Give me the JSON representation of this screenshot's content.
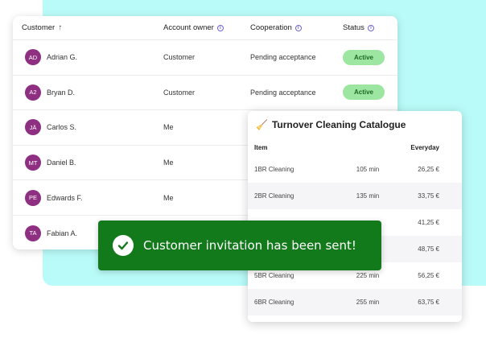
{
  "colors": {
    "background_panel": "#b9fbf8",
    "avatar": "#8e2f82",
    "badge_bg": "#9ce6a2",
    "badge_text": "#1d6a24",
    "toast_bg": "#137a1c",
    "info_icon": "#6d65d8"
  },
  "customers_table": {
    "headers": {
      "customer": "Customer",
      "account_owner": "Account owner",
      "cooperation": "Cooperation",
      "status": "Status"
    },
    "rows": [
      {
        "initials": "AD",
        "name": "Adrian G.",
        "owner": "Customer",
        "cooperation": "Pending acceptance",
        "status": "Active"
      },
      {
        "initials": "A2",
        "name": "Bryan D.",
        "owner": "Customer",
        "cooperation": "Pending acceptance",
        "status": "Active"
      },
      {
        "initials": "JÄ",
        "name": "Carlos S.",
        "owner": "Me",
        "cooperation": "",
        "status": ""
      },
      {
        "initials": "MT",
        "name": "Daniel B.",
        "owner": "Me",
        "cooperation": "",
        "status": ""
      },
      {
        "initials": "PE",
        "name": "Edwards F.",
        "owner": "Me",
        "cooperation": "",
        "status": ""
      },
      {
        "initials": "TA",
        "name": "Fabian A.",
        "owner": "",
        "cooperation": "",
        "status": ""
      }
    ]
  },
  "catalogue": {
    "icon": "broom-icon",
    "title": "Turnover Cleaning Catalogue",
    "headers": {
      "item": "Item",
      "price": "Everyday"
    },
    "rows": [
      {
        "item": "1BR Cleaning",
        "duration": "105 min",
        "price": "26,25 €"
      },
      {
        "item": "2BR Cleaning",
        "duration": "135 min",
        "price": "33,75 €"
      },
      {
        "item": "",
        "duration": "",
        "price": "41,25 €"
      },
      {
        "item": "",
        "duration": "",
        "price": "48,75 €"
      },
      {
        "item": "5BR Cleaning",
        "duration": "225 min",
        "price": "56,25 €"
      },
      {
        "item": "6BR Cleaning",
        "duration": "255 min",
        "price": "63,75 €"
      }
    ]
  },
  "toast": {
    "icon": "check-circle-icon",
    "message": "Customer invitation has been sent!"
  }
}
